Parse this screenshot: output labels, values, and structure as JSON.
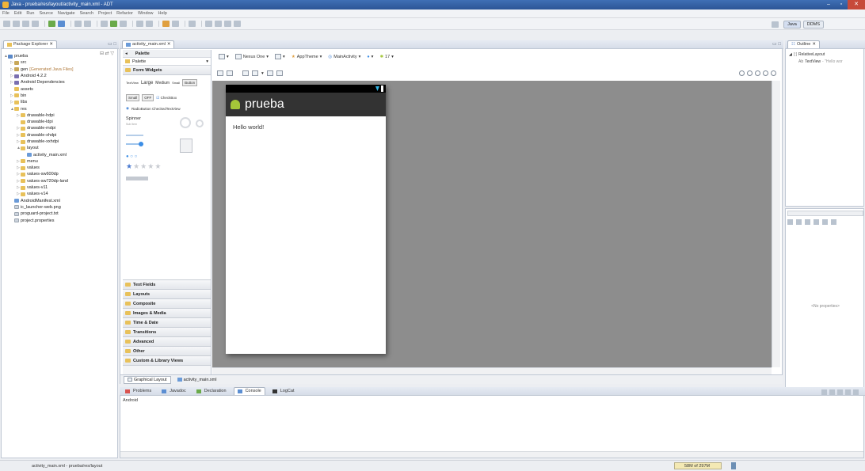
{
  "window": {
    "title": "Java - prueba/res/layout/activity_main.xml - ADT",
    "controls": [
      "–",
      "▫",
      "✕"
    ]
  },
  "menu": [
    "File",
    "Edit",
    "Run",
    "Source",
    "Navigate",
    "Search",
    "Project",
    "Refactor",
    "Window",
    "Help"
  ],
  "perspectives": [
    "Java",
    "DDMS"
  ],
  "package_explorer": {
    "title": "Package Explorer",
    "tree": [
      {
        "label": "prueba",
        "indent": 0,
        "icon": "proj",
        "arrow": "▲"
      },
      {
        "label": "src",
        "indent": 1,
        "icon": "pkgic",
        "arrow": "▷"
      },
      {
        "label": "gen",
        "extra": "[Generated Java Files]",
        "indent": 1,
        "icon": "pkgic",
        "arrow": "▷"
      },
      {
        "label": "Android 4.2.2",
        "indent": 1,
        "icon": "lib",
        "arrow": "▷"
      },
      {
        "label": "Android Dependencies",
        "indent": 1,
        "icon": "lib",
        "arrow": "▷"
      },
      {
        "label": "assets",
        "indent": 1,
        "icon": "folder",
        "arrow": ""
      },
      {
        "label": "bin",
        "indent": 1,
        "icon": "folder",
        "arrow": "▷"
      },
      {
        "label": "libs",
        "indent": 1,
        "icon": "folder",
        "arrow": "▷"
      },
      {
        "label": "res",
        "indent": 1,
        "icon": "folder",
        "arrow": "▲"
      },
      {
        "label": "drawable-hdpi",
        "indent": 2,
        "icon": "folder",
        "arrow": "▷"
      },
      {
        "label": "drawable-ldpi",
        "indent": 2,
        "icon": "folder",
        "arrow": ""
      },
      {
        "label": "drawable-mdpi",
        "indent": 2,
        "icon": "folder",
        "arrow": "▷"
      },
      {
        "label": "drawable-xhdpi",
        "indent": 2,
        "icon": "folder",
        "arrow": "▷"
      },
      {
        "label": "drawable-xxhdpi",
        "indent": 2,
        "icon": "folder",
        "arrow": "▷"
      },
      {
        "label": "layout",
        "indent": 2,
        "icon": "folder",
        "arrow": "▲"
      },
      {
        "label": "activity_main.xml",
        "indent": 3,
        "icon": "xml",
        "arrow": ""
      },
      {
        "label": "menu",
        "indent": 2,
        "icon": "folder",
        "arrow": "▷"
      },
      {
        "label": "values",
        "indent": 2,
        "icon": "folder",
        "arrow": "▷"
      },
      {
        "label": "values-sw600dp",
        "indent": 2,
        "icon": "folder",
        "arrow": "▷"
      },
      {
        "label": "values-sw720dp-land",
        "indent": 2,
        "icon": "folder",
        "arrow": "▷"
      },
      {
        "label": "values-v11",
        "indent": 2,
        "icon": "folder",
        "arrow": "▷"
      },
      {
        "label": "values-v14",
        "indent": 2,
        "icon": "folder",
        "arrow": "▷"
      },
      {
        "label": "AndroidManifest.xml",
        "indent": 1,
        "icon": "xml",
        "arrow": ""
      },
      {
        "label": "ic_launcher-web.png",
        "indent": 1,
        "icon": "file",
        "arrow": ""
      },
      {
        "label": "proguard-project.txt",
        "indent": 1,
        "icon": "file",
        "arrow": ""
      },
      {
        "label": "project.properties",
        "indent": 1,
        "icon": "file",
        "arrow": ""
      }
    ]
  },
  "editor": {
    "tab_label": "activity_main.xml",
    "palette": {
      "title": "Palette",
      "filter": "Palette",
      "open_category": "Form Widgets",
      "widgets": {
        "text_sizes": [
          "TextView",
          "Large",
          "Medium",
          "Small",
          "Button"
        ],
        "small_row": [
          "Small",
          "OFF",
          "CheckBox"
        ],
        "radio": "RadioButton CheckedTextView",
        "spinner_title": "Spinner",
        "spinner_sub": "Sub Item"
      },
      "categories": [
        "Text Fields",
        "Layouts",
        "Composite",
        "Images & Media",
        "Time & Date",
        "Transitions",
        "Advanced",
        "Other",
        "Custom & Library Views"
      ]
    },
    "canvas_toolbar": {
      "device": "Nexus One",
      "theme": "AppTheme",
      "activity": "MainActivity",
      "api": "17"
    },
    "device_preview": {
      "app_title": "prueba",
      "text": "Hello world!"
    },
    "bottom_tabs": [
      "Graphical Layout",
      "activity_main.xml"
    ]
  },
  "outline": {
    "title": "Outline",
    "root": "RelativeLayout",
    "child": "TextView",
    "child_value": "- \"Hello wor"
  },
  "properties": {
    "empty_text": "<No properties>"
  },
  "console": {
    "tabs": [
      "Problems",
      "Javadoc",
      "Declaration",
      "Console",
      "LogCat"
    ],
    "active_tab": "Console",
    "label": "Android"
  },
  "statusbar": {
    "path": "activity_main.xml - prueba/res/layout",
    "heap": "58M of 297M"
  },
  "colors": {
    "titlebar": "#2c5596",
    "canvas_bg": "#8d8d8d",
    "actionbar": "#333333",
    "android_green": "#a4c639"
  }
}
